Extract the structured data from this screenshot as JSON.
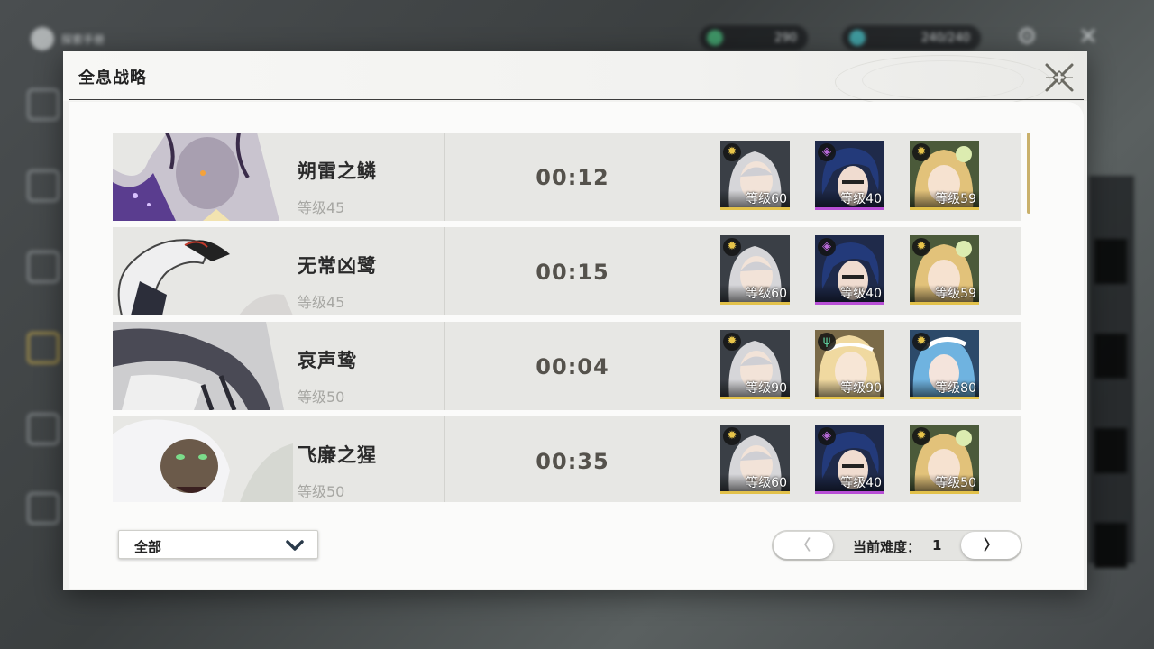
{
  "background": {
    "top_left_label": "探索手册",
    "currency": [
      {
        "icon": "green-gem-icon",
        "value": "290"
      },
      {
        "icon": "stamina-icon",
        "value": "240/240"
      }
    ]
  },
  "dialog": {
    "title": "全息战略",
    "close_icon": "close-x-icon"
  },
  "rows": [
    {
      "boss_name": "朔雷之鳞",
      "boss_level": "等级45",
      "time": "00:12",
      "team": [
        {
          "level": "等级60",
          "element": "spectro-icon",
          "rarity": "gold"
        },
        {
          "level": "等级40",
          "element": "havoc-icon",
          "rarity": "purple"
        },
        {
          "level": "等级59",
          "element": "spectro-icon",
          "rarity": "gold"
        }
      ]
    },
    {
      "boss_name": "无常凶鹭",
      "boss_level": "等级45",
      "time": "00:15",
      "team": [
        {
          "level": "等级60",
          "element": "spectro-icon",
          "rarity": "gold"
        },
        {
          "level": "等级40",
          "element": "havoc-icon",
          "rarity": "purple"
        },
        {
          "level": "等级59",
          "element": "spectro-icon",
          "rarity": "gold"
        }
      ]
    },
    {
      "boss_name": "哀声鸷",
      "boss_level": "等级50",
      "time": "00:04",
      "team": [
        {
          "level": "等级90",
          "element": "spectro-icon",
          "rarity": "gold"
        },
        {
          "level": "等级90",
          "element": "aero-icon",
          "rarity": "gold"
        },
        {
          "level": "等级80",
          "element": "spectro-icon",
          "rarity": "gold"
        }
      ]
    },
    {
      "boss_name": "飞廉之猩",
      "boss_level": "等级50",
      "time": "00:35",
      "team": [
        {
          "level": "等级60",
          "element": "spectro-icon",
          "rarity": "gold"
        },
        {
          "level": "等级40",
          "element": "havoc-icon",
          "rarity": "purple"
        },
        {
          "level": "等级50",
          "element": "spectro-icon",
          "rarity": "gold"
        }
      ]
    }
  ],
  "footer": {
    "filter_value": "全部",
    "prev_label": "〈",
    "next_label": "〉",
    "difficulty_label": "当前难度：",
    "difficulty_value": "1"
  },
  "colors": {
    "rarity_gold": "#e2c14a",
    "rarity_purple": "#b84fd6",
    "accent_scroll": "#c9b06b"
  }
}
